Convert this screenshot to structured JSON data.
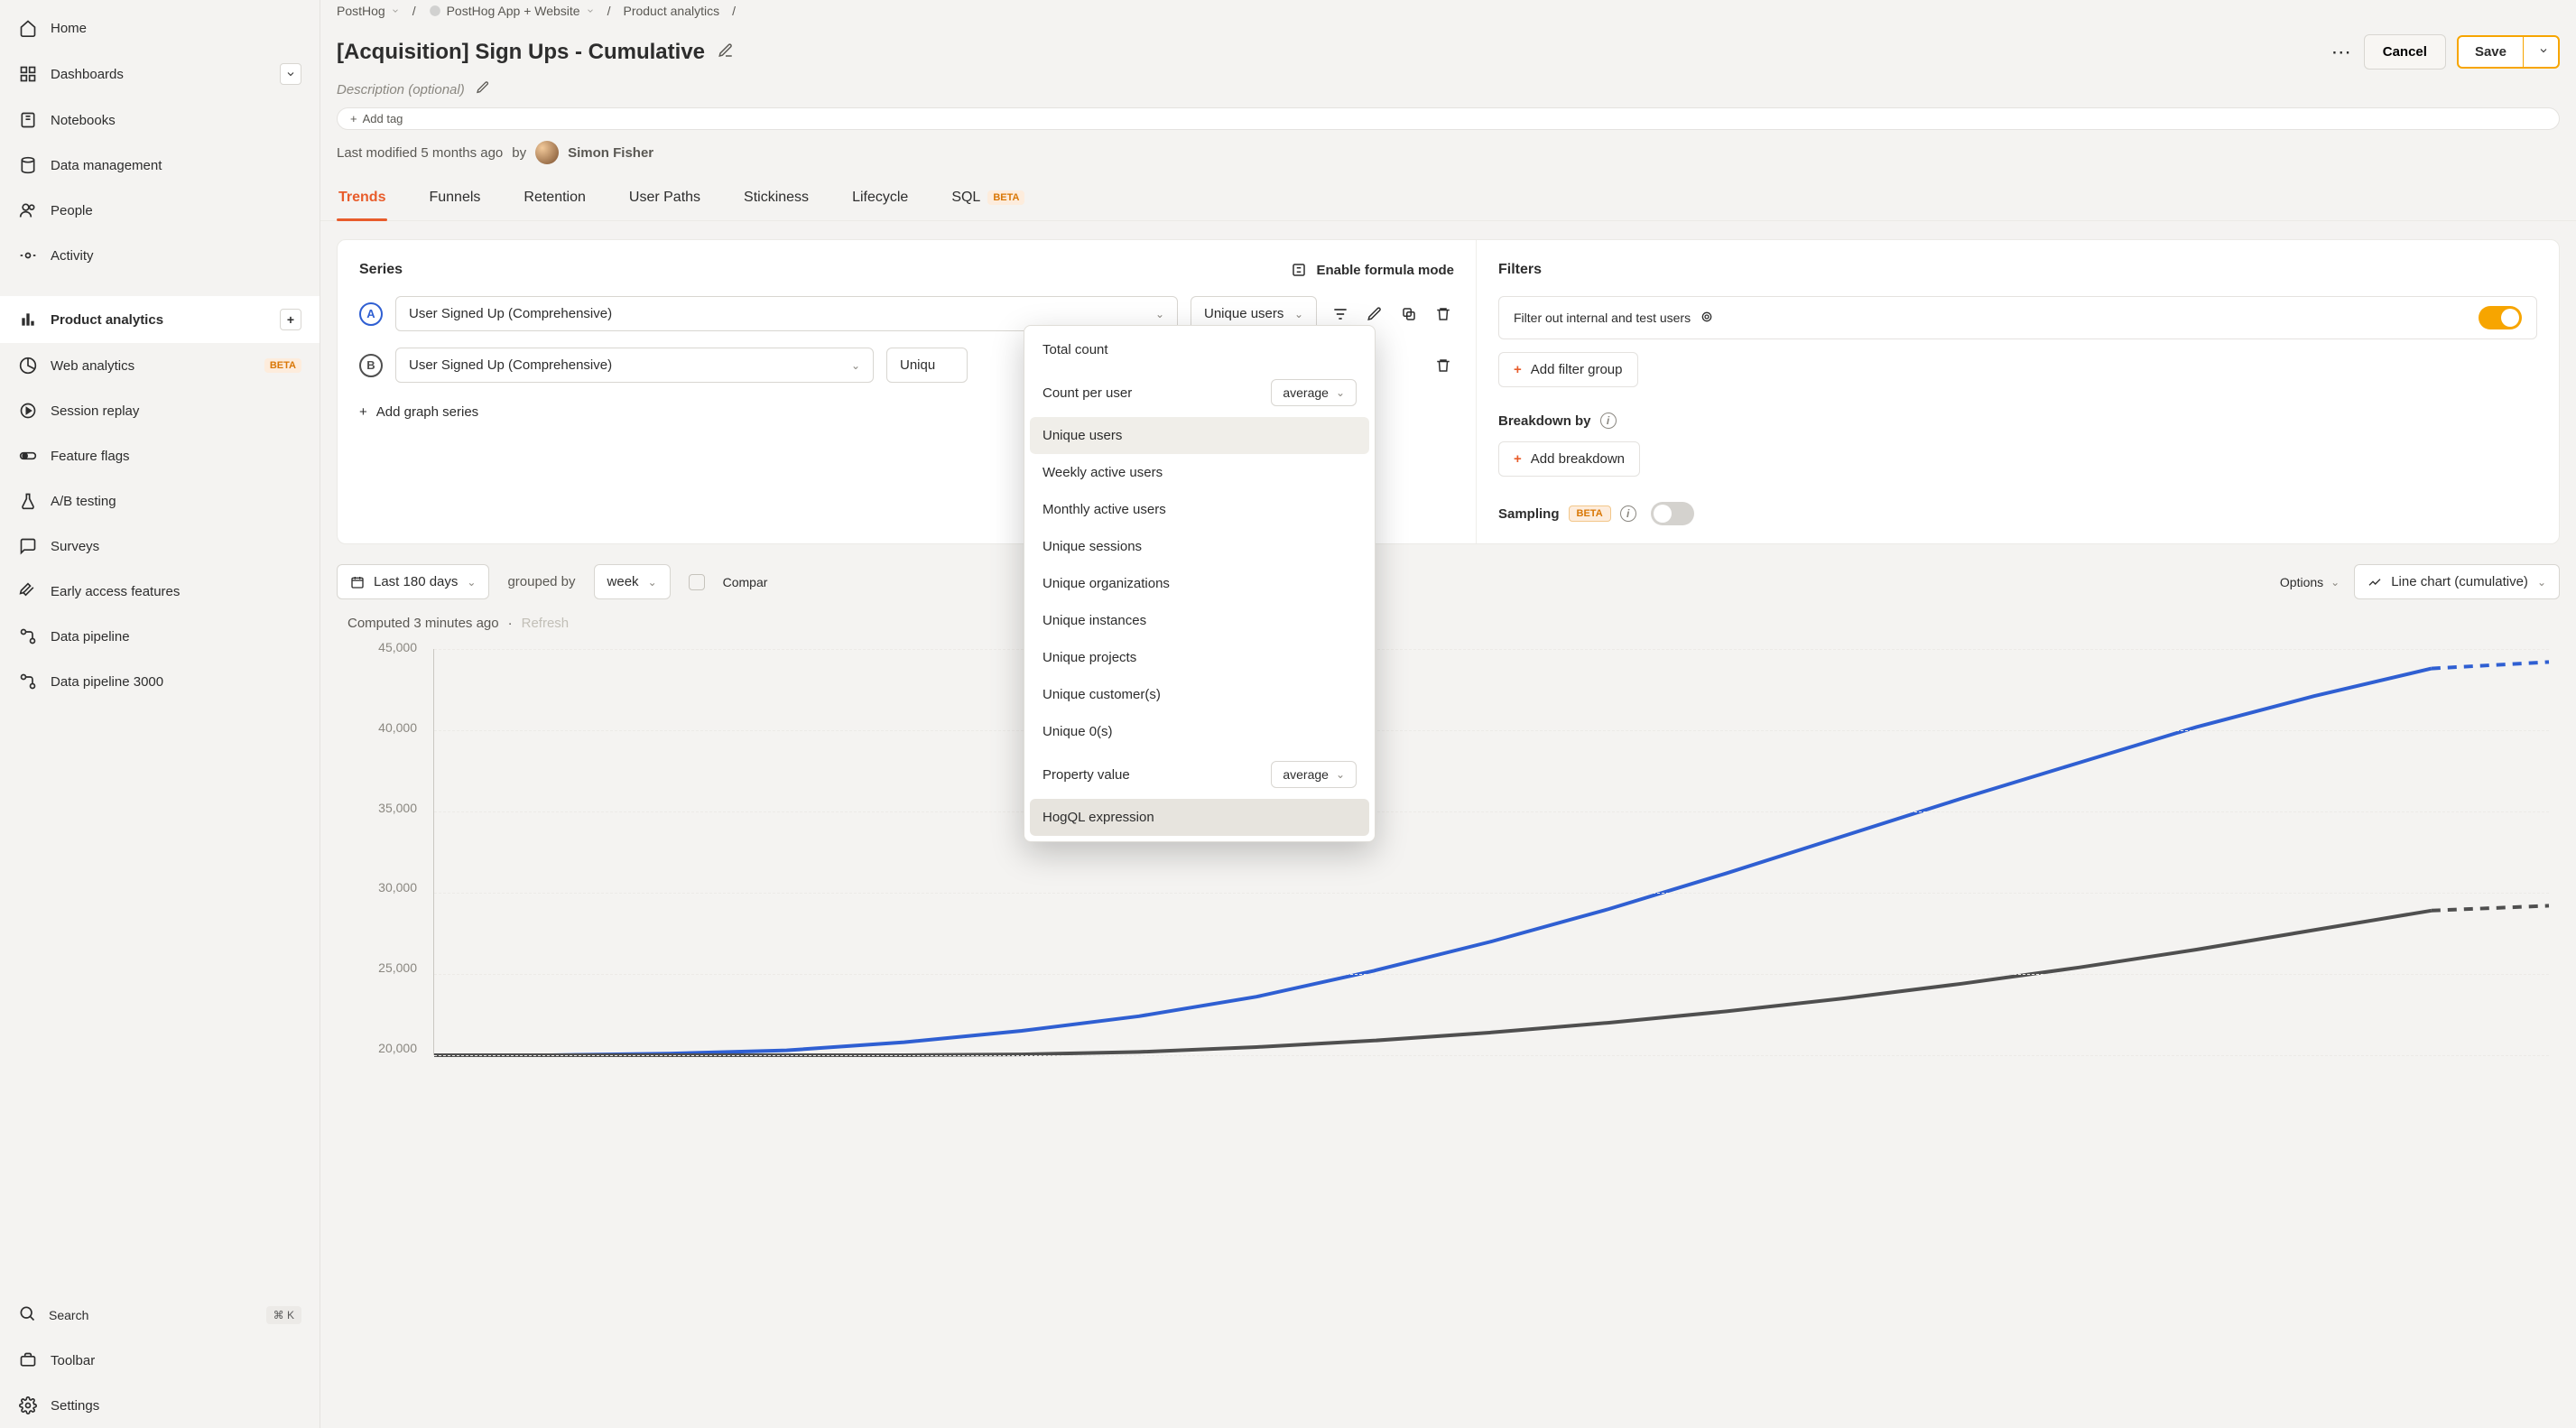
{
  "sidebar": {
    "items": [
      {
        "label": "Home",
        "icon": "home"
      },
      {
        "label": "Dashboards",
        "icon": "dashboard",
        "chevron": true
      },
      {
        "label": "Notebooks",
        "icon": "notebook"
      },
      {
        "label": "Data management",
        "icon": "database"
      },
      {
        "label": "People",
        "icon": "people"
      },
      {
        "label": "Activity",
        "icon": "activity"
      }
    ],
    "products": [
      {
        "label": "Product analytics",
        "icon": "bars",
        "active": true,
        "plus": true
      },
      {
        "label": "Web analytics",
        "icon": "pie",
        "beta": "BETA"
      },
      {
        "label": "Session replay",
        "icon": "replay"
      },
      {
        "label": "Feature flags",
        "icon": "toggle"
      },
      {
        "label": "A/B testing",
        "icon": "flask"
      },
      {
        "label": "Surveys",
        "icon": "chat"
      },
      {
        "label": "Early access features",
        "icon": "rocket"
      },
      {
        "label": "Data pipeline",
        "icon": "pipeline"
      },
      {
        "label": "Data pipeline 3000",
        "icon": "pipeline"
      }
    ],
    "footer": {
      "search": "Search",
      "kbd": "⌘ K",
      "toolbar": "Toolbar",
      "settings": "Settings"
    }
  },
  "breadcrumbs": [
    "PostHog",
    "PostHog App + Website",
    "Product analytics"
  ],
  "title": "[Acquisition] Sign Ups - Cumulative",
  "description_placeholder": "Description (optional)",
  "add_tag": "Add tag",
  "modified": {
    "prefix": "Last modified 5 months ago",
    "by": "by",
    "name": "Simon Fisher"
  },
  "header_buttons": {
    "cancel": "Cancel",
    "save": "Save"
  },
  "tabs": [
    "Trends",
    "Funnels",
    "Retention",
    "User Paths",
    "Stickiness",
    "Lifecycle",
    "SQL"
  ],
  "sql_beta": "BETA",
  "series": {
    "title": "Series",
    "formula": "Enable formula mode",
    "rows": [
      {
        "badge": "A",
        "event": "User Signed Up (Comprehensive)",
        "math": "Unique users"
      },
      {
        "badge": "B",
        "event": "User Signed Up (Comprehensive)",
        "math": "Uniqu"
      }
    ],
    "add": "Add graph series"
  },
  "dropdown": {
    "items": [
      {
        "label": "Total count"
      },
      {
        "label": "Count per user",
        "mini": "average"
      },
      {
        "label": "Unique users",
        "selected": true
      },
      {
        "label": "Weekly active users"
      },
      {
        "label": "Monthly active users"
      },
      {
        "label": "Unique sessions"
      },
      {
        "label": "Unique organizations"
      },
      {
        "label": "Unique instances"
      },
      {
        "label": "Unique projects"
      },
      {
        "label": "Unique customer(s)"
      },
      {
        "label": "Unique 0(s)"
      },
      {
        "label": "Property value",
        "mini": "average"
      },
      {
        "label": "HogQL expression",
        "highlight": true
      }
    ]
  },
  "filters": {
    "title": "Filters",
    "chip": "Filter out internal and test users",
    "add_group": "Add filter group",
    "breakdown": "Breakdown by",
    "add_breakdown": "Add breakdown",
    "sampling": "Sampling",
    "sampling_beta": "BETA"
  },
  "controls": {
    "date": "Last 180 days",
    "grouped_by": "grouped by",
    "interval": "week",
    "compare": "Compar",
    "options": "Options",
    "chart_type": "Line chart (cumulative)"
  },
  "computed": {
    "text": "Computed 3 minutes ago",
    "refresh": "Refresh"
  },
  "chart_data": {
    "type": "line",
    "title": "",
    "xlabel": "",
    "ylabel": "",
    "ylim": [
      20000,
      45000
    ],
    "y_ticks": [
      45000,
      40000,
      35000,
      30000,
      25000,
      20000
    ],
    "series": [
      {
        "name": "A",
        "color": "#2f5fd2",
        "dashed_tail": true,
        "values": [
          20000,
          20000,
          20100,
          20300,
          20800,
          21500,
          22400,
          23600,
          25200,
          27000,
          29000,
          31200,
          33500,
          35800,
          38000,
          40200,
          42100,
          43800,
          44200
        ]
      },
      {
        "name": "B",
        "color": "#4f4f4f",
        "dashed_tail": true,
        "values": [
          20000,
          20000,
          20000,
          20000,
          20000,
          20050,
          20200,
          20500,
          20900,
          21400,
          22000,
          22700,
          23500,
          24400,
          25400,
          26500,
          27700,
          28900,
          29200
        ]
      }
    ]
  }
}
